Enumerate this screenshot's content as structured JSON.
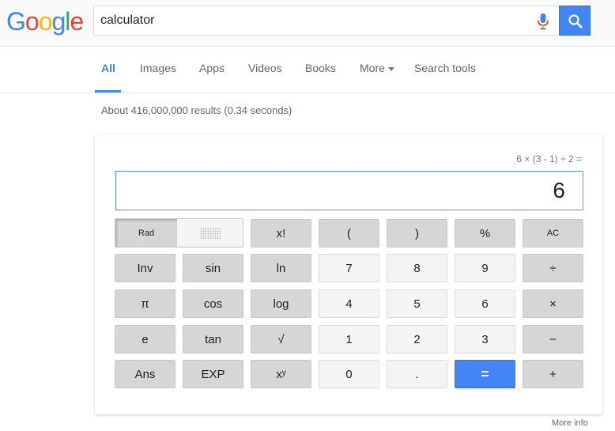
{
  "header": {
    "logo": [
      "G",
      "o",
      "o",
      "g",
      "l",
      "e"
    ],
    "logo_colors": [
      "#4285f4",
      "#ea4335",
      "#fbbc05",
      "#4285f4",
      "#34a853",
      "#ea4335"
    ],
    "search_value": "calculator"
  },
  "tabs": {
    "all": "All",
    "images": "Images",
    "apps": "Apps",
    "videos": "Videos",
    "books": "Books",
    "more": "More",
    "search_tools": "Search tools"
  },
  "result_stats": "About 416,000,000 results (0.34 seconds)",
  "calculator": {
    "expression": "6 × (3 - 1) ÷ 2 =",
    "display": "6",
    "rad_label": "Rad",
    "keys": {
      "r1": [
        "x!",
        "(",
        ")",
        "%",
        "AC"
      ],
      "r2": [
        "Inv",
        "sin",
        "ln",
        "7",
        "8",
        "9",
        "÷"
      ],
      "r3": [
        "π",
        "cos",
        "log",
        "4",
        "5",
        "6",
        "×"
      ],
      "r4": [
        "e",
        "tan",
        "√",
        "1",
        "2",
        "3",
        "−"
      ],
      "r5": [
        "Ans",
        "EXP",
        "xʸ",
        "0",
        ".",
        "=",
        "+"
      ]
    }
  },
  "more_info": "More info",
  "colors": {
    "accent": "#4285f4",
    "key_dark": "#d6d6d6",
    "key_light": "#f5f5f5"
  }
}
